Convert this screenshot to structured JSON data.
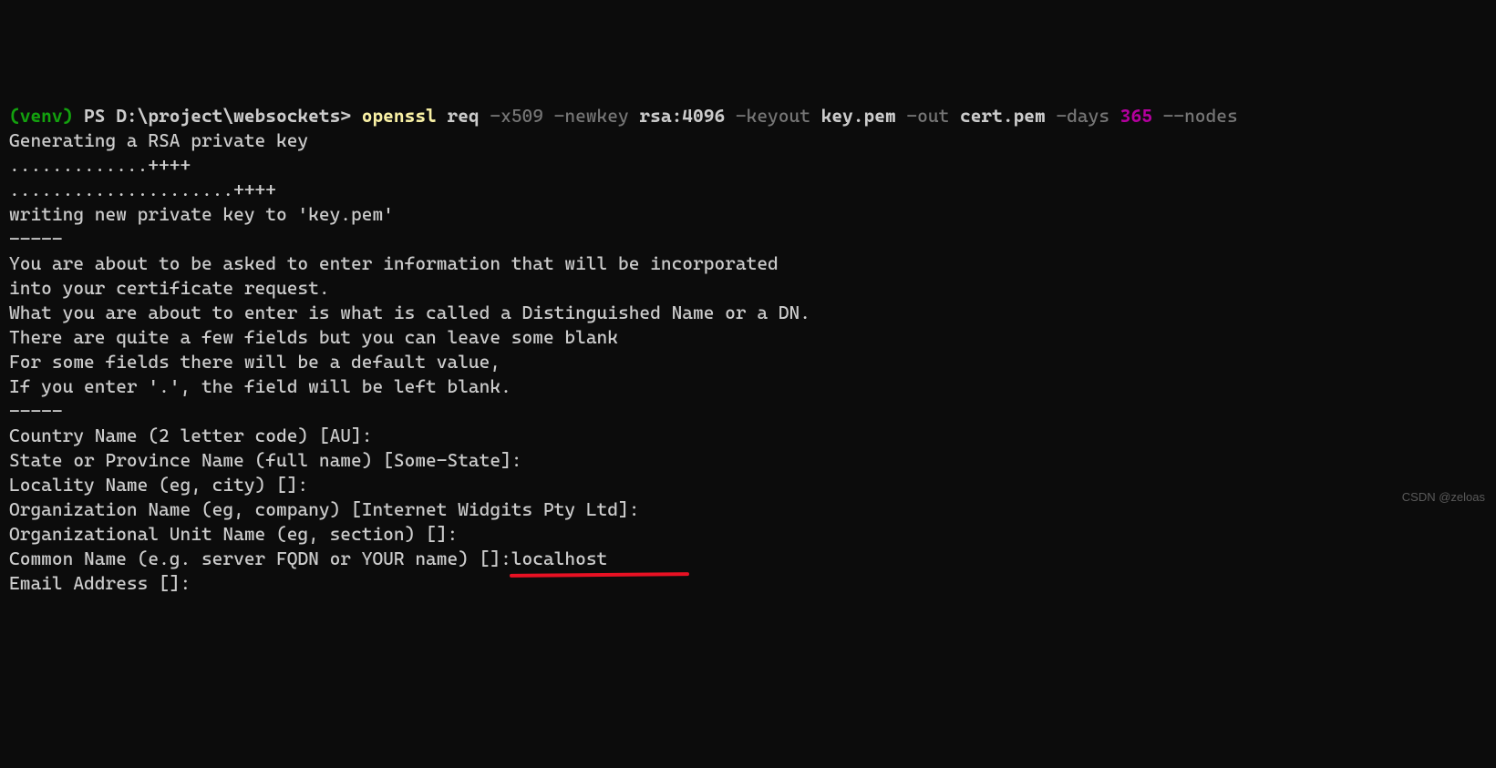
{
  "prompt": {
    "venv": "(venv)",
    "ps": " PS D:\\project\\websockets> ",
    "cmd": "openssl",
    "sp": " ",
    "arg_req": "req ",
    "flag_x509": "-x509 ",
    "flag_newkey": "-newkey ",
    "val_rsa": "rsa:4096 ",
    "flag_keyout": "-keyout ",
    "val_keypem": "key.pem ",
    "flag_out": "-out ",
    "val_certpem": "cert.pem ",
    "flag_days": "-days ",
    "val_365": "365 ",
    "flag_nodes": "--nodes"
  },
  "out": {
    "l1": "Generating a RSA private key",
    "l2": ".............++++",
    "l3": ".....................++++",
    "l4": "writing new private key to 'key.pem'",
    "l5": "-----",
    "l6": "You are about to be asked to enter information that will be incorporated",
    "l7": "into your certificate request.",
    "l8": "What you are about to enter is what is called a Distinguished Name or a DN.",
    "l9": "There are quite a few fields but you can leave some blank",
    "l10": "For some fields there will be a default value,",
    "l11": "If you enter '.', the field will be left blank.",
    "l12": "-----",
    "l13": "Country Name (2 letter code) [AU]:",
    "l14": "State or Province Name (full name) [Some-State]:",
    "l15": "Locality Name (eg, city) []:",
    "l16": "Organization Name (eg, company) [Internet Widgits Pty Ltd]:",
    "l17": "Organizational Unit Name (eg, section) []:",
    "l18a": "Common Name (e.g. server FQDN or YOUR name) []:",
    "l18b": "localhost",
    "l19": "Email Address []:"
  },
  "watermark": "CSDN @zeloas"
}
